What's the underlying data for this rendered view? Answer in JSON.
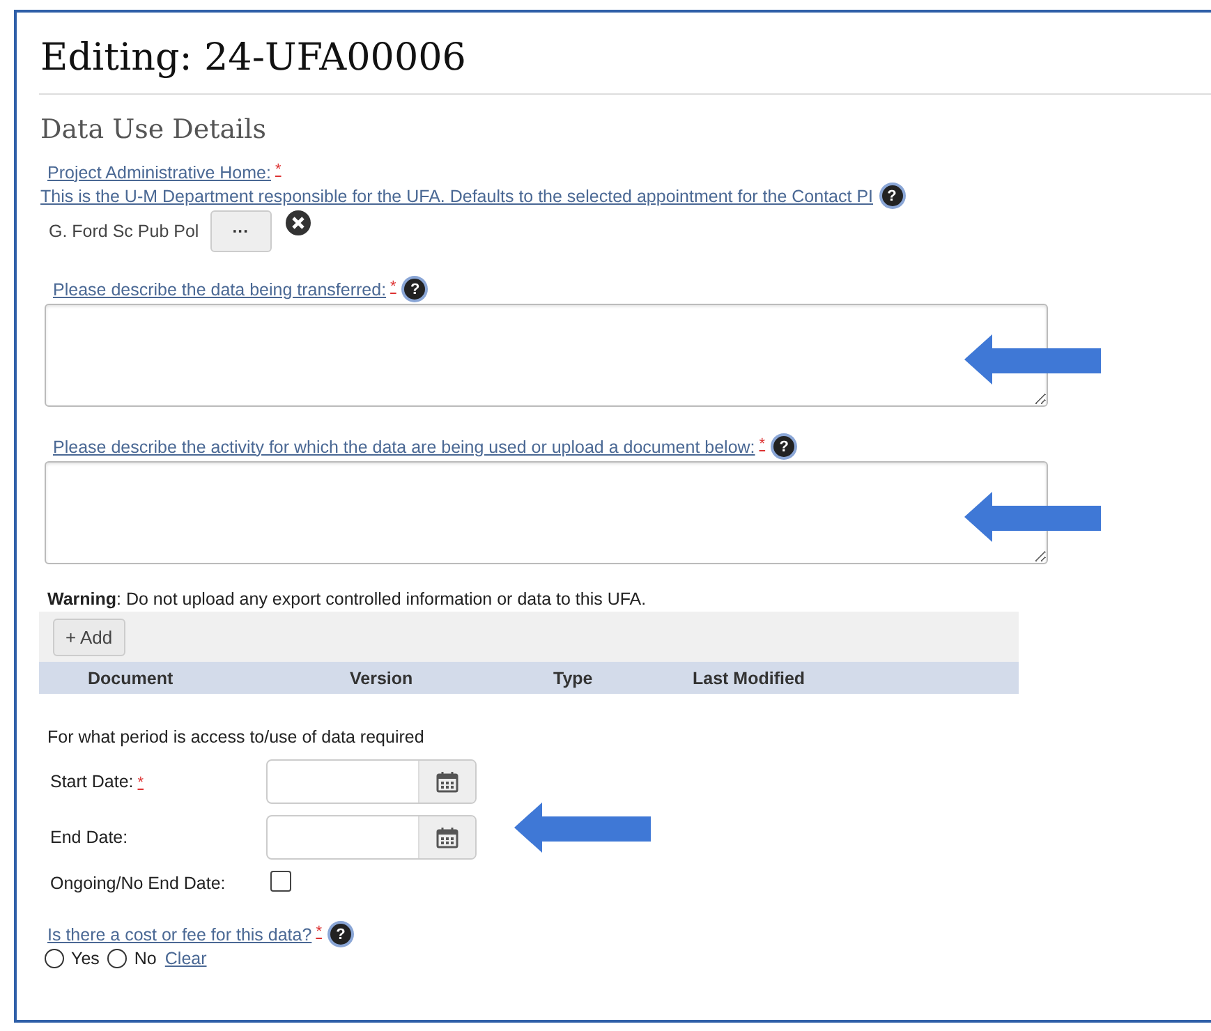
{
  "page": {
    "title": "Editing: 24-UFA00006"
  },
  "section": {
    "title": "Data Use Details"
  },
  "admin_home": {
    "label": "Project Administrative Home:",
    "required_mark": "*",
    "description": "This is the U-M Department responsible for the UFA. Defaults to the selected appointment for the Contact PI",
    "help": "?",
    "value": "G. Ford Sc Pub Pol",
    "browse_button": "···"
  },
  "text_questions": [
    {
      "label": "Please describe the data being transferred:",
      "required_mark": "*",
      "help": "?",
      "annotated": true
    },
    {
      "label": "Please describe the activity for which the data are being used or upload a document below:",
      "required_mark": "*",
      "help": "?",
      "annotated": true
    }
  ],
  "warning": {
    "label": "Warning",
    "text": ": Do not upload any export controlled information or data to this UFA."
  },
  "documents": {
    "add_button": "+ Add",
    "columns": [
      "Document",
      "Version",
      "Type",
      "Last Modified"
    ]
  },
  "period": {
    "heading": "For what period is access to/use of data required",
    "annotated": true,
    "dates": [
      {
        "label": "Start Date:",
        "required_mark": "*"
      },
      {
        "label": "End Date:"
      }
    ],
    "ongoing": {
      "label": "Ongoing/No End Date:",
      "checked": false
    }
  },
  "cost": {
    "label": "Is there a cost or fee for this data?",
    "required_mark": "*",
    "help": "?",
    "options": [
      {
        "label": "Yes",
        "selected": false
      },
      {
        "label": "No",
        "selected": false
      }
    ],
    "clear_link": "Clear"
  }
}
